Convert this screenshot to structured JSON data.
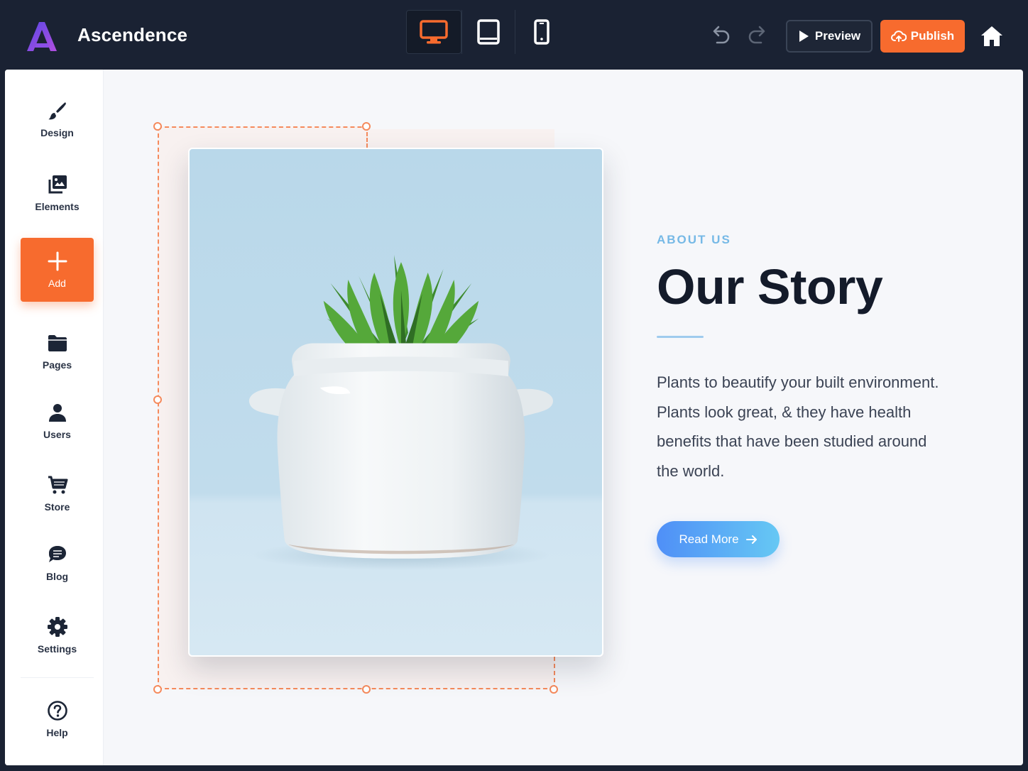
{
  "app": {
    "name": "Ascendence"
  },
  "toolbar": {
    "devices": [
      {
        "icon": "desktop-icon",
        "active": true
      },
      {
        "icon": "tablet-icon",
        "active": false
      },
      {
        "icon": "mobile-icon",
        "active": false
      }
    ],
    "preview_label": "Preview",
    "publish_label": "Publish"
  },
  "sidebar": {
    "items": [
      {
        "label": "Design",
        "icon": "brush-icon"
      },
      {
        "label": "Elements",
        "icon": "elements-icon"
      },
      {
        "label": "Add",
        "icon": "plus-icon"
      },
      {
        "label": "Pages",
        "icon": "folder-icon"
      },
      {
        "label": "Users",
        "icon": "user-icon"
      },
      {
        "label": "Store",
        "icon": "cart-icon"
      },
      {
        "label": "Blog",
        "icon": "chat-icon"
      },
      {
        "label": "Settings",
        "icon": "gear-icon"
      },
      {
        "label": "Help",
        "icon": "help-icon"
      }
    ]
  },
  "content": {
    "eyebrow": "ABOUT US",
    "headline": "Our Story",
    "body": "Plants to beautify your built environment. Plants look great, & they have health benefits that have been studied around the world.",
    "cta_label": "Read More"
  },
  "colors": {
    "topbar_bg": "#1a2233",
    "accent_orange": "#f76b2e",
    "eyebrow_blue": "#76b9e6",
    "cta_gradient_start": "#4f8ff7",
    "cta_gradient_end": "#66c8f4"
  }
}
